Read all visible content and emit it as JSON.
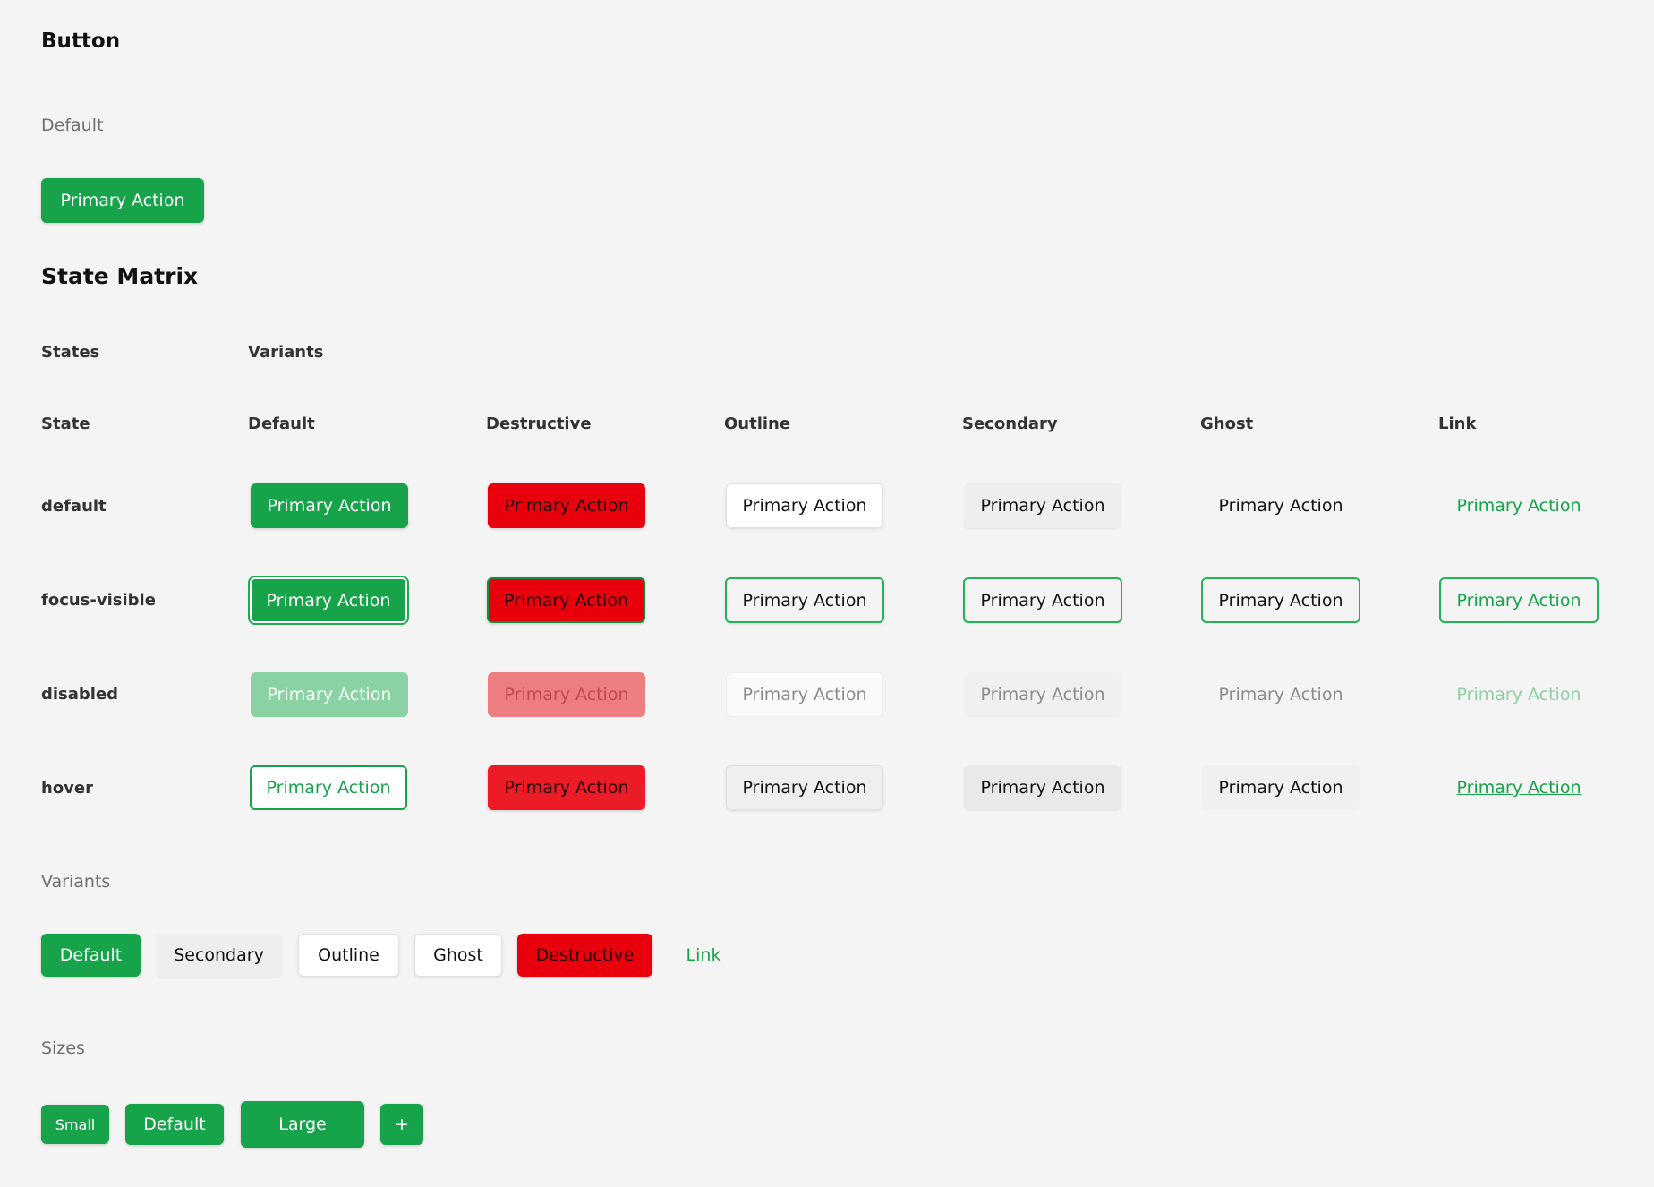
{
  "page": {
    "title": "Button",
    "default_section": {
      "label": "Default",
      "button_label": "Primary Action"
    },
    "state_matrix": {
      "title": "State Matrix",
      "group_headers": {
        "states": "States",
        "variants": "Variants"
      },
      "column_headers": [
        "State",
        "Default",
        "Destructive",
        "Outline",
        "Secondary",
        "Ghost",
        "Link"
      ],
      "rows": [
        {
          "state": "default",
          "cells": [
            "Primary Action",
            "Primary Action",
            "Primary Action",
            "Primary Action",
            "Primary Action",
            "Primary Action"
          ]
        },
        {
          "state": "focus-visible",
          "cells": [
            "Primary Action",
            "Primary Action",
            "Primary Action",
            "Primary Action",
            "Primary Action",
            "Primary Action"
          ]
        },
        {
          "state": "disabled",
          "cells": [
            "Primary Action",
            "Primary Action",
            "Primary Action",
            "Primary Action",
            "Primary Action",
            "Primary Action"
          ]
        },
        {
          "state": "hover",
          "cells": [
            "Primary Action",
            "Primary Action",
            "Primary Action",
            "Primary Action",
            "Primary Action",
            "Primary Action"
          ]
        }
      ]
    },
    "variants_section": {
      "label": "Variants",
      "buttons": [
        "Default",
        "Secondary",
        "Outline",
        "Ghost",
        "Destructive",
        "Link"
      ]
    },
    "sizes_section": {
      "label": "Sizes",
      "buttons": [
        "Small",
        "Default",
        "Large",
        "+"
      ]
    }
  },
  "colors": {
    "background": "#f4f4f4",
    "primary": "#16a34a",
    "destructive": "#e8000d",
    "focus_ring": "#22b357"
  }
}
